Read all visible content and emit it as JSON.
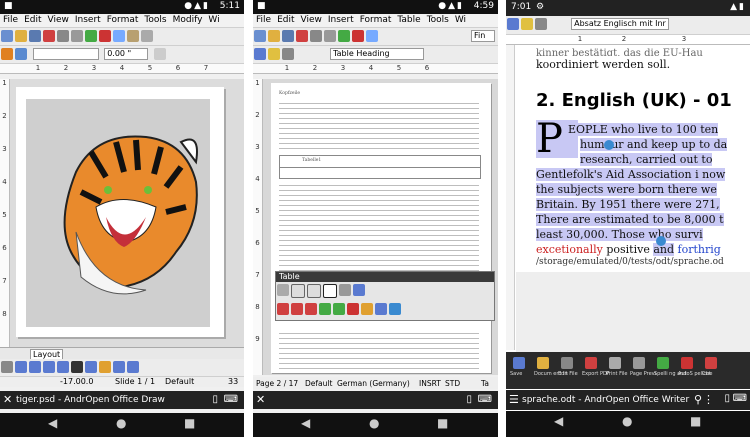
{
  "phone1": {
    "status": {
      "time": "5:11"
    },
    "menu": [
      "File",
      "Edit",
      "View",
      "Insert",
      "Format",
      "Tools",
      "Modify",
      "Wi"
    ],
    "line_width": "0.00 \"",
    "ruler": [
      "1",
      "2",
      "3",
      "4",
      "5",
      "6",
      "7"
    ],
    "left_ruler": [
      "1",
      "2",
      "3",
      "4",
      "5",
      "6",
      "7",
      "8"
    ],
    "layout_tab": "Layout",
    "status_line": {
      "coords": "-17.00.0",
      "slide": "Slide 1 / 1",
      "layout": "Default",
      "zoom": "33"
    },
    "app_title": "tiger.psd - AndrOpen Office Draw"
  },
  "phone2": {
    "status": {
      "time": "4:59"
    },
    "menu": [
      "File",
      "Edit",
      "View",
      "Insert",
      "Format",
      "Table",
      "Tools",
      "Wi"
    ],
    "paragraph_style": "Table Heading",
    "font_field": "Fin",
    "ruler": [
      "1",
      "2",
      "3",
      "4",
      "5",
      "6"
    ],
    "left_ruler": [
      "1",
      "2",
      "3",
      "4",
      "5",
      "6",
      "7",
      "8",
      "9"
    ],
    "doc_heading": "Kopfzeile",
    "table_cell": "Tabelle1",
    "table_panel_title": "Table",
    "status_line": {
      "page": "Page 2 / 17",
      "style": "Default",
      "lang": "German (Germany)",
      "mode": "INSRT",
      "sel": "STD",
      "extra": "Ta"
    }
  },
  "phone3": {
    "status": {
      "time": "7:01"
    },
    "paragraph_style": "Absatz Englisch mit Inr",
    "ruler": [
      "1",
      "2",
      "3"
    ],
    "top_text_1": "kinner bestätigt, das die EU-Hau",
    "top_text_2": "koordiniert werden soll.",
    "heading": "2. English (UK) - 01",
    "dropcap": "P",
    "lines": [
      "EOPLE who live to 100 ten",
      "humour and keep up to da",
      "research, carried out to",
      "Gentlefolk's Aid Association i now",
      "the subjects were born there we",
      "Britain. By 1951 there were 271,",
      "There are estimated to be 8,000 t",
      "least 30,000. Those who survi"
    ],
    "red_word": "excetionally",
    "mid_word": " positive ",
    "and_word": "and",
    "blue_word": " forthrig",
    "path": "/storage/emulated/0/tests/odt/sprache.od",
    "bottom_tools": [
      "Save",
      "Docum ent in",
      "Edit File",
      "Export PDF",
      "Print File",
      "Page Previ",
      "Spelli ng and",
      "AutoS pellche",
      "Cut"
    ],
    "app_title": "sprache.odt - AndrOpen Office Writer"
  }
}
